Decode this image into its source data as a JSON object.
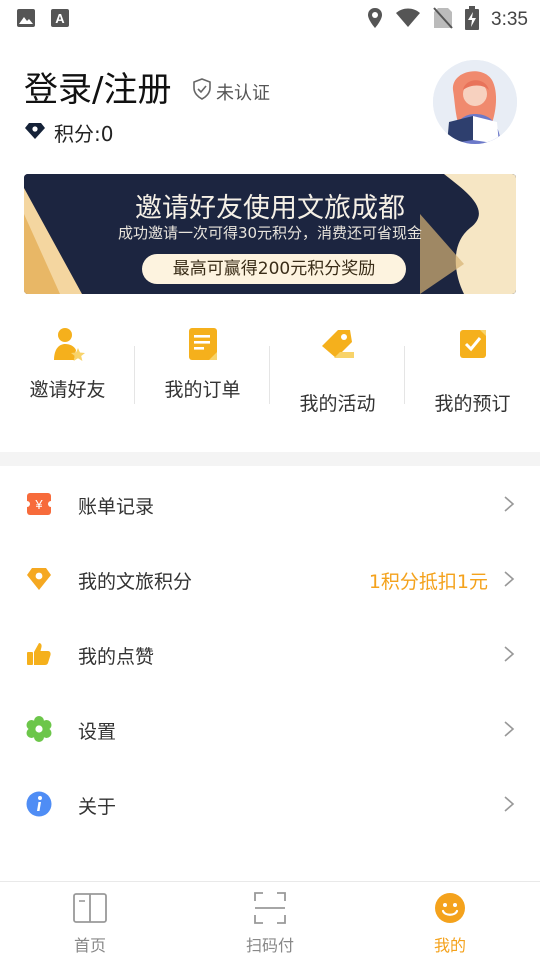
{
  "status_bar": {
    "time": "3:35",
    "icons": [
      "image-icon",
      "font-icon",
      "location-icon",
      "wifi-icon",
      "no-sim-icon",
      "battery-charging-icon"
    ]
  },
  "profile": {
    "login_label": "登录/注册",
    "verify_label": "未认证",
    "points_label": "积分:0",
    "avatar_icon": "avatar-woman-reading"
  },
  "banner": {
    "title": "邀请好友使用文旅成都",
    "subtitle": "成功邀请一次可得30元积分，消费还可省现金",
    "pill": "最高可赢得200元积分奖励"
  },
  "quick_actions": [
    {
      "label": "邀请好友",
      "icon": "invite-friend-icon"
    },
    {
      "label": "我的订单",
      "icon": "order-icon"
    },
    {
      "label": "我的活动",
      "icon": "activity-tag-icon"
    },
    {
      "label": "我的预订",
      "icon": "booking-icon"
    }
  ],
  "menu": [
    {
      "label": "账单记录",
      "icon": "bill-icon",
      "extra": ""
    },
    {
      "label": "我的文旅积分",
      "icon": "points-diamond-icon",
      "extra": "1积分抵扣1元"
    },
    {
      "label": "我的点赞",
      "icon": "thumbs-up-icon",
      "extra": ""
    },
    {
      "label": "设置",
      "icon": "settings-gear-icon",
      "extra": ""
    },
    {
      "label": "关于",
      "icon": "info-icon",
      "extra": ""
    }
  ],
  "bottom_nav": [
    {
      "label": "首页",
      "icon": "home-book-icon",
      "active": false
    },
    {
      "label": "扫码付",
      "icon": "scan-icon",
      "active": false
    },
    {
      "label": "我的",
      "icon": "me-smile-icon",
      "active": true
    }
  ],
  "colors": {
    "accent": "#f4a21c",
    "banner_bg": "#1c2540",
    "divider": "#f4f4f4"
  }
}
